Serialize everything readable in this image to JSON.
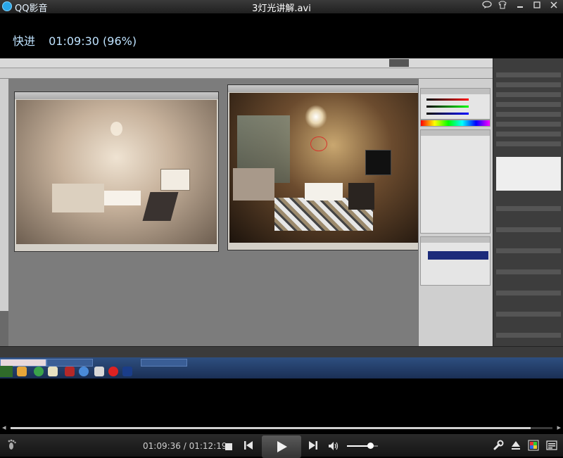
{
  "titlebar": {
    "app_name": "QQ影音",
    "window_title": "3灯光讲解.avi",
    "icons": [
      "chat-bubble-icon",
      "skin-icon",
      "minimize-icon",
      "maximize-icon",
      "close-icon"
    ]
  },
  "osd": {
    "mode": "快进",
    "position": "01:09:30 (96%)"
  },
  "player": {
    "time_display": "01:09:36 / 01:12:19",
    "progress_fraction": 0.96,
    "volume_fraction": 0.75
  },
  "colors": {
    "accent": "#2aa7e8",
    "osd_text": "#bfe3ff",
    "background": "#000000"
  }
}
